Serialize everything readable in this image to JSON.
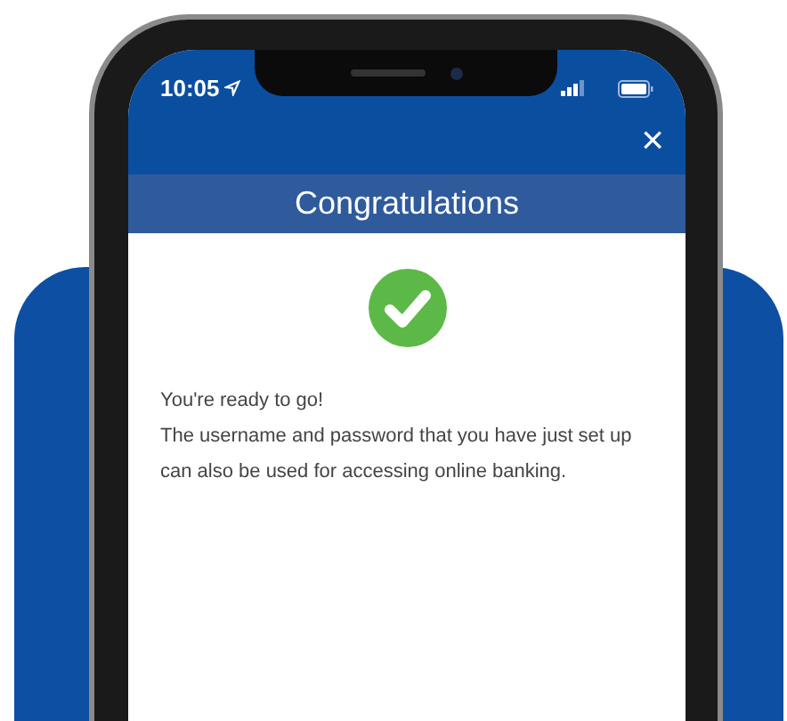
{
  "status_bar": {
    "time": "10:05"
  },
  "header": {
    "close": "×",
    "title": "Congratulations"
  },
  "message": {
    "heading": "You're ready to go!",
    "body": "The username and password that you have just set up can also be used for accessing online banking."
  }
}
